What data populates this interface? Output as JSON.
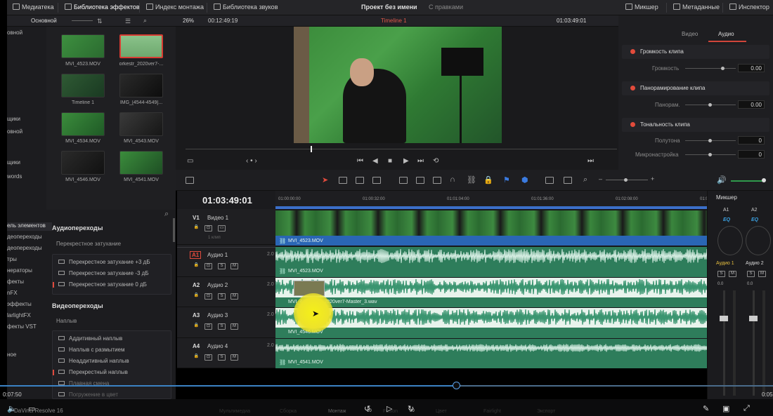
{
  "toolbar": {
    "media": "Медиатека",
    "effects": "Библиотека эффектов",
    "edit_index": "Индекс монтажа",
    "sound_lib": "Библиотека звуков",
    "project": "Проект без имени",
    "project_sub": "С правками",
    "mixer": "Микшер",
    "metadata": "Метаданные",
    "inspector": "Инспектор"
  },
  "media_pool": {
    "bin": "Основной",
    "side_items": [
      "овной",
      "щики",
      "овной",
      "щики",
      "words"
    ],
    "clips": [
      {
        "name": "MVI_4523.MOV"
      },
      {
        "name": "orkestr_2020ver7-..."
      },
      {
        "name": "Timeline 1"
      },
      {
        "name": "IMG_[4544-4549]..."
      },
      {
        "name": "MVI_4534.MOV"
      },
      {
        "name": "MVI_4543.MOV"
      },
      {
        "name": "MVI_4546.MOV"
      },
      {
        "name": "MVI_4541.MOV"
      }
    ]
  },
  "viewer": {
    "zoom": "26%",
    "timecode_left": "00:12:49:19",
    "timeline_name": "Timeline 1",
    "timecode_right": "01:03:49:01"
  },
  "inspector": {
    "tab_video": "Видео",
    "tab_audio": "Аудио",
    "sections": [
      {
        "title": "Громкость клипа",
        "rows": [
          {
            "label": "Громкость",
            "value": "0.00"
          }
        ]
      },
      {
        "title": "Панорамирование клипа",
        "rows": [
          {
            "label": "Панорам.",
            "value": "0.00"
          }
        ]
      },
      {
        "title": "Тональность клипа",
        "rows": [
          {
            "label": "Полутона",
            "value": "0"
          },
          {
            "label": "Микронастройка",
            "value": "0"
          }
        ]
      }
    ]
  },
  "timeline": {
    "timecode": "01:03:49:01",
    "ruler": [
      "01:00:00:00",
      "01:00:32:00",
      "01:01:04:00",
      "01:01:36:00",
      "01:02:08:00",
      "01:02:40:00"
    ],
    "tracks": [
      {
        "id": "V1",
        "name": "Видео 1",
        "vol": "",
        "clip": "MVI_4523.MOV",
        "sub": "1 клип"
      },
      {
        "id": "A1",
        "name": "Аудио 1",
        "vol": "2.0",
        "clip": "MVI_4523.MOV"
      },
      {
        "id": "A2",
        "name": "Аудио 2",
        "vol": "2.0",
        "clip": "MVI_4...orkestr_2020ver7-Master_3.wav"
      },
      {
        "id": "A3",
        "name": "Аудио 3",
        "vol": "2.0",
        "clip": "MVI_4546.MOV"
      },
      {
        "id": "A4",
        "name": "Аудио 4",
        "vol": "2.0",
        "clip": "MVI_4541.MOV"
      }
    ]
  },
  "effects": {
    "side_items": [
      "ель элементов",
      "деопереходы",
      "деопереходы",
      "тры",
      "нераторы",
      "фекты",
      "nFX",
      "эффекты",
      "larlightFX",
      "фекты VST",
      "ное"
    ],
    "audio_title": "Аудиопереходы",
    "audio_group": "Перекрестное затухание",
    "audio_items": [
      "Перекрестное затухание +3 дБ",
      "Перекрестное затухание -3 дБ",
      "Перекрестное затухание 0 дБ"
    ],
    "video_title": "Видеопереходы",
    "video_group": "Наплыв",
    "video_items": [
      "Аддитивный наплыв",
      "Наплыв с размытием",
      "Неаддитивный наплыв",
      "Перекрестный наплыв",
      "Плавная смена",
      "Погружение в цвет"
    ]
  },
  "mixer": {
    "title": "Микшер",
    "ch1": "A1",
    "ch2": "A2",
    "eq": "EQ",
    "bus1": "Аудио 1",
    "bus2": "Аудио 2",
    "val1": "0.0",
    "val2": "0.0"
  },
  "player": {
    "time_left": "0:07:50",
    "time_right": "0:05",
    "app": "DaVinci Resolve 16",
    "progress": 0.59,
    "rewind": "10",
    "forward": "30",
    "pages": [
      "Мультимедиа",
      "Сборка",
      "Монтаж",
      "Fusion",
      "Цвет",
      "Fairlight",
      "Экспорт"
    ]
  }
}
